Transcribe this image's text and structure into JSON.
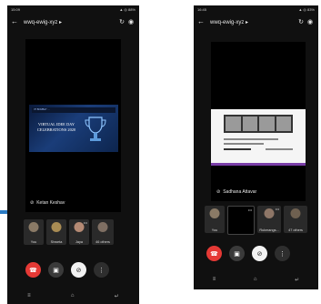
{
  "left": {
    "status_time": "15:09",
    "status_right": "▲ ◎ 88%",
    "meeting_title": "wwq-ewig-xyz ▸",
    "speaker": "Ketan Keshav",
    "slide_header": "IIT BOMBAY ...",
    "slide_title": "VIRTUAL IDEE DAY CELEBRATIONS 2020",
    "tiles": [
      {
        "label": "You"
      },
      {
        "label": "Shweta"
      },
      {
        "label": "Jaya"
      },
      {
        "label": "46 others"
      }
    ]
  },
  "right": {
    "status_time": "16:45",
    "status_right": "▲ ◎ 83%",
    "meeting_title": "wwq-ewig-xyz ▸",
    "speaker": "Sadhana Attavar",
    "slide_caption": "...",
    "tiles": [
      {
        "label": "You"
      },
      {
        "label": ""
      },
      {
        "label": "Rukmangs..."
      },
      {
        "label": "47 others"
      }
    ]
  },
  "colors": {
    "end_call": "#e53935",
    "connector": "#2a7bc4"
  },
  "icons": {
    "back": "←",
    "camera_switch": "↻",
    "speaker": "◉",
    "end": "☎",
    "video_off": "▣",
    "mic_off": "⊘",
    "more": "⋮",
    "nav_menu": "≡",
    "nav_home": "⌂",
    "nav_back": "↵"
  }
}
